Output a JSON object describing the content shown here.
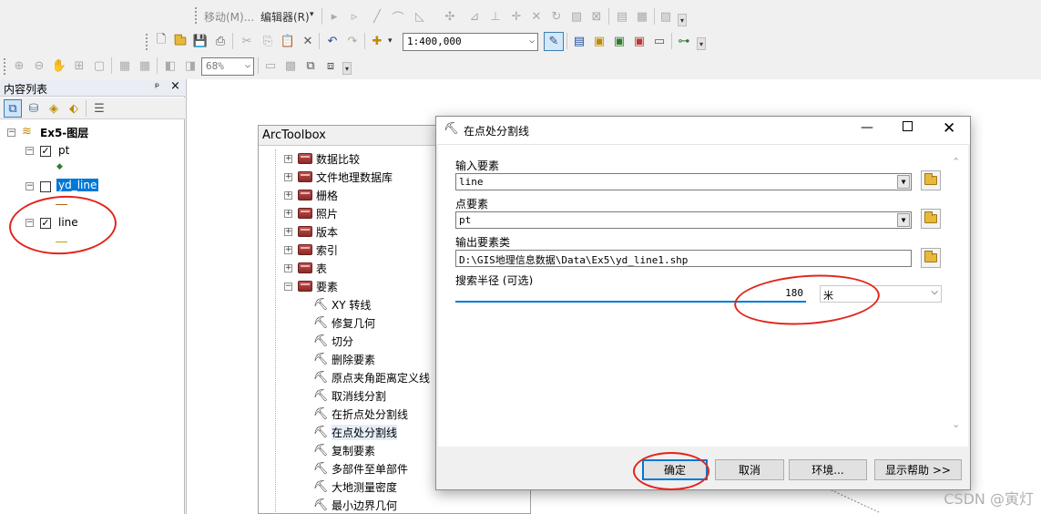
{
  "toolbar1": {
    "move_menu": "移动(M)...",
    "editor_menu": "编辑器(R)"
  },
  "toolbar2": {
    "scale": "1:400,000"
  },
  "toolbar3": {
    "zoom": "68%"
  },
  "toc": {
    "title": "内容列表",
    "pin": "ᵖ",
    "close": "×",
    "root": "Ex5-图层",
    "layers": [
      {
        "name": "pt",
        "checked": true,
        "selected": false
      },
      {
        "name": "yd_line",
        "checked": false,
        "selected": true
      },
      {
        "name": "line",
        "checked": true,
        "selected": false
      }
    ]
  },
  "arctoolbox": {
    "title": "ArcToolbox",
    "toolsets": [
      "数据比较",
      "文件地理数据库",
      "栅格",
      "照片",
      "版本",
      "索引",
      "表",
      "要素"
    ],
    "tools": [
      "XY 转线",
      "修复几何",
      "切分",
      "删除要素",
      "原点夹角距离定义线",
      "取消线分割",
      "在折点处分割线",
      "在点处分割线",
      "复制要素",
      "多部件至单部件",
      "大地测量密度",
      "最小边界几何"
    ]
  },
  "dialog": {
    "title": "在点处分割线",
    "input_features_label": "输入要素",
    "input_features_value": "line",
    "point_features_label": "点要素",
    "point_features_value": "pt",
    "output_label": "输出要素类",
    "output_value": "D:\\GIS地理信息数据\\Data\\Ex5\\yd_line1.shp",
    "radius_label": "搜索半径 (可选)",
    "radius_value": "180",
    "unit_value": "米",
    "ok": "确定",
    "cancel": "取消",
    "env": "环境...",
    "help": "显示帮助 >>"
  },
  "watermark": "CSDN @寅灯",
  "colors": {
    "selection": "#0078d7",
    "annotation": "#e0261d"
  }
}
